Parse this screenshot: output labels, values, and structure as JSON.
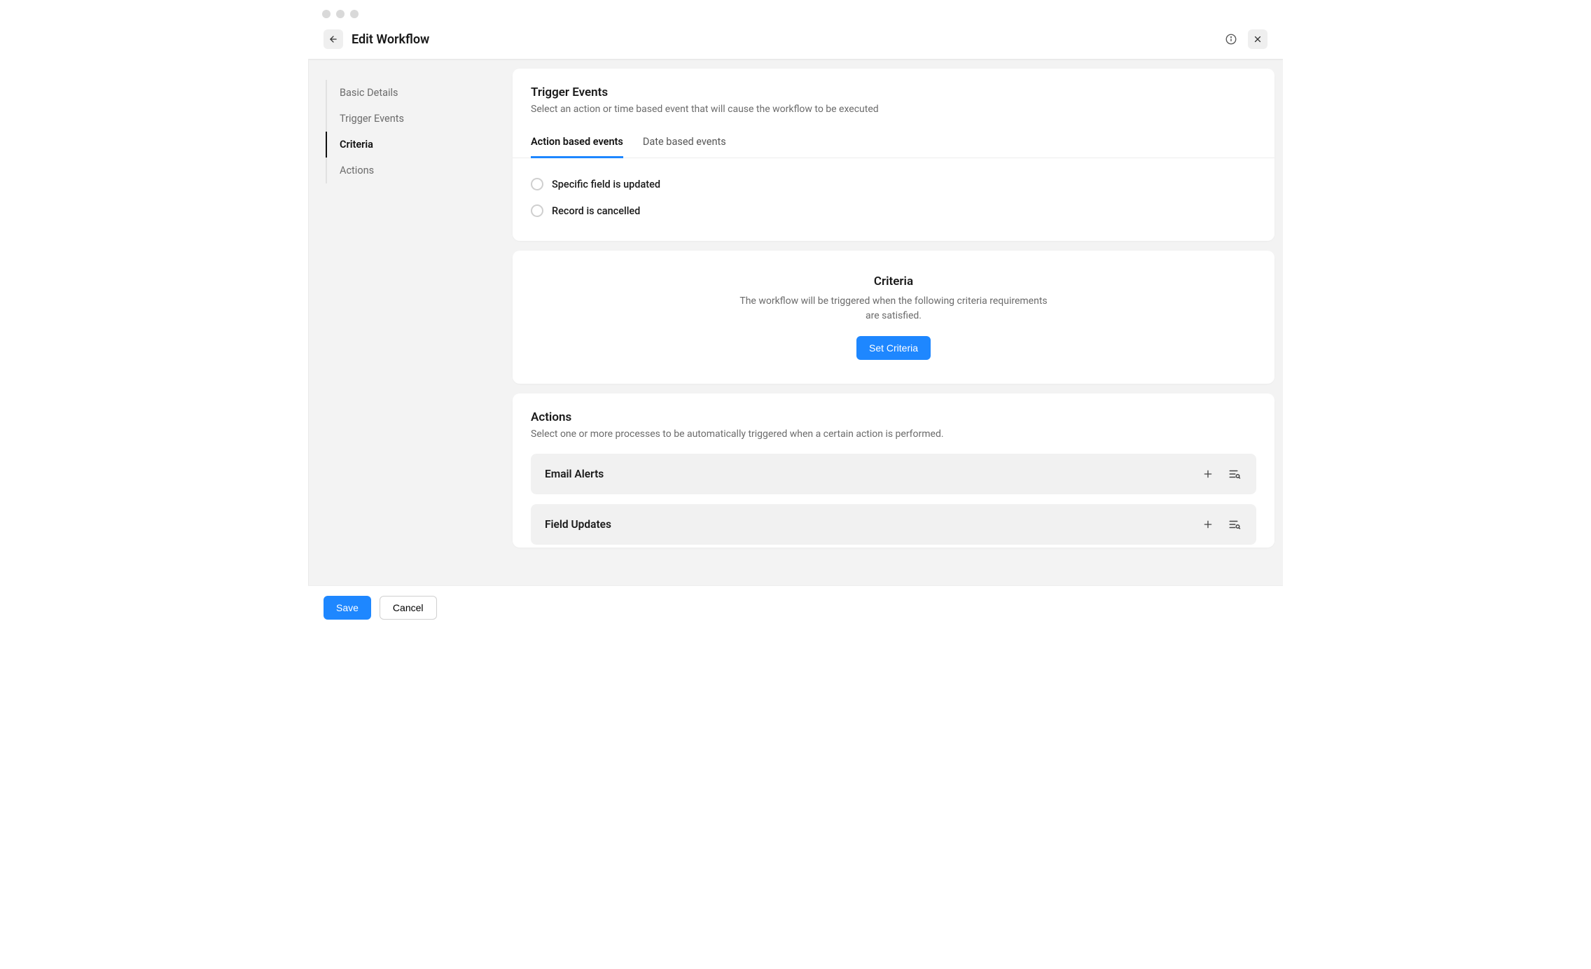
{
  "header": {
    "title": "Edit Workflow"
  },
  "sidebar": {
    "items": [
      {
        "label": "Basic Details",
        "active": false
      },
      {
        "label": "Trigger Events",
        "active": false
      },
      {
        "label": "Criteria",
        "active": true
      },
      {
        "label": "Actions",
        "active": false
      }
    ]
  },
  "trigger_events": {
    "title": "Trigger Events",
    "desc": "Select an action or time based event that will cause the workflow to be executed",
    "tabs": [
      {
        "label": "Action based events",
        "active": true
      },
      {
        "label": "Date based events",
        "active": false
      }
    ],
    "options": [
      {
        "label": "Specific field is updated"
      },
      {
        "label": "Record is cancelled"
      }
    ]
  },
  "criteria": {
    "title": "Criteria",
    "desc": "The workflow will be triggered when the following criteria requirements are satisfied.",
    "button": "Set Criteria"
  },
  "actions": {
    "title": "Actions",
    "desc": "Select one or more processes to be automatically triggered when a certain action is performed.",
    "blocks": [
      {
        "label": "Email Alerts"
      },
      {
        "label": "Field Updates"
      }
    ]
  },
  "footer": {
    "save": "Save",
    "cancel": "Cancel"
  }
}
